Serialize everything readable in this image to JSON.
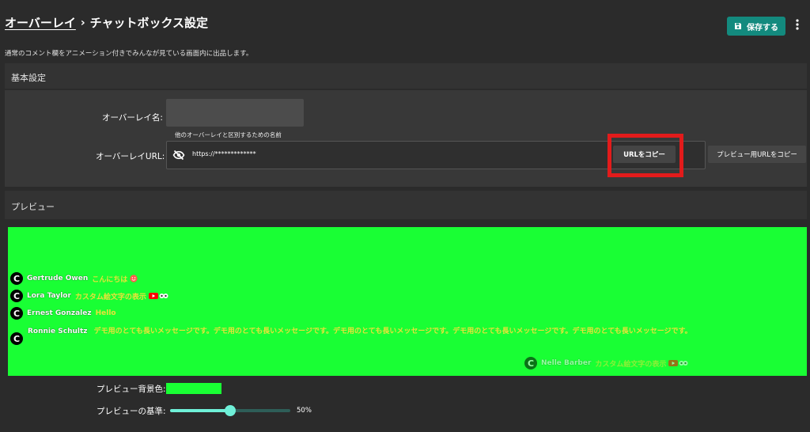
{
  "header": {
    "breadcrumb_root": "オーバーレイ",
    "breadcrumb_sep": "›",
    "title": "チャットボックス設定",
    "save_label": "保存する",
    "save_icon": "floppy-disk-icon",
    "more_icon": "vertical-dots-icon"
  },
  "description": "通常のコメント欄をアニメーション付きでみんなが見ている画面内に出品します。",
  "basic": {
    "section_title": "基本設定",
    "name_label": "オーバーレイ名:",
    "name_value": "",
    "name_hint": "他のオーバーレイと区別するための名前",
    "url_label": "オーバーレイURL:",
    "url_value": "https://*************",
    "visibility_icon": "eye-off-icon",
    "copy_url_label": "URLをコピー",
    "copy_preview_url_label": "プレビュー用URLをコピー"
  },
  "preview": {
    "section_title": "プレビュー",
    "bg_color": "#19ff34",
    "messages": [
      {
        "author": "Gertrude Owen",
        "text": "こんにちは",
        "emoji": "smiley-icon"
      },
      {
        "author": "Lora Taylor",
        "text": "カスタム絵文字の表示",
        "emoji": "youtube-and-custom-emoji"
      },
      {
        "author": "Ernest Gonzalez",
        "text": "Hello"
      },
      {
        "author": "Ronnie Schultz",
        "text": "デモ用のとても長いメッセージです。デモ用のとても長いメッセージです。デモ用のとても長いメッセージです。デモ用のとても長いメッセージです。デモ用のとても長いメッセージです。"
      },
      {
        "author": "Nelle Barber",
        "text": "カスタム絵文字の表示",
        "emoji": "youtube-and-custom-emoji"
      }
    ],
    "msg_color": "#e8e23a",
    "bg_color_label": "プレビュー背景色:",
    "scale_label": "プレビューの基準:",
    "scale_value": "50%",
    "scale_fraction": 0.5
  },
  "colors": {
    "accent": "#138a7e",
    "slider": "#6ff0d8",
    "highlight": "#e21b1b"
  }
}
